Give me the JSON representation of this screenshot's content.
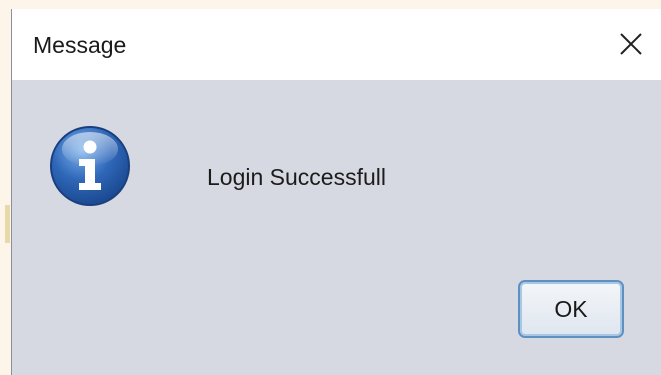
{
  "dialog": {
    "title": "Message",
    "message": "Login Successfull",
    "ok_label": "OK"
  },
  "icons": {
    "close": "close-icon",
    "info": "info-icon"
  },
  "colors": {
    "dialog_background": "#d6d9e1",
    "titlebar_background": "#ffffff",
    "icon_blue": "#2f67b8",
    "button_border": "#5f90c2"
  }
}
